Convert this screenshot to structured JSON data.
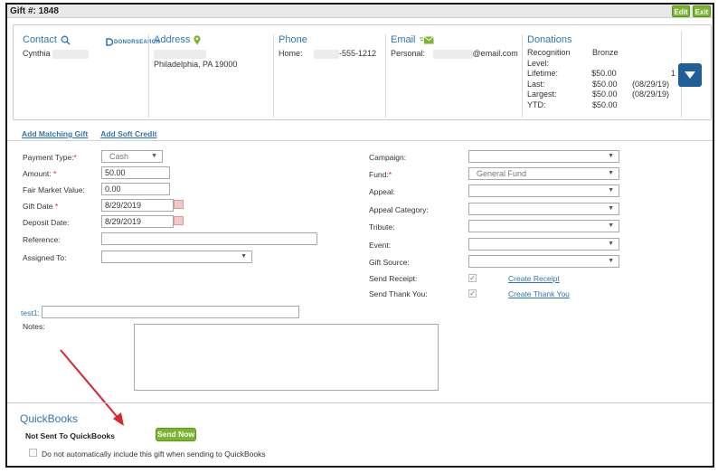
{
  "header": {
    "gift_title": "Gift #: 1848",
    "edit_label": "Edit",
    "exit_label": "Exit"
  },
  "contact": {
    "heading": "Contact",
    "name": "Cynthia",
    "brand": "DONORSEARCH"
  },
  "address": {
    "heading": "Address",
    "city_line": "Philadelphia, PA 19000"
  },
  "phone": {
    "heading": "Phone",
    "label": "Home:",
    "number": "-555-1212"
  },
  "email": {
    "heading": "Email",
    "label": "Personal:",
    "domain": "@email.com"
  },
  "donations": {
    "heading": "Donations",
    "rows": [
      {
        "label": "Recognition Level:",
        "amount": "Bronze",
        "extra": ""
      },
      {
        "label": "Lifetime:",
        "amount": "$50.00",
        "extra": "1"
      },
      {
        "label": "Last:",
        "amount": "$50.00",
        "extra": "(08/29/19)"
      },
      {
        "label": "Largest:",
        "amount": "$50.00",
        "extra": "(08/29/19)"
      },
      {
        "label": "YTD:",
        "amount": "$50.00",
        "extra": ""
      }
    ]
  },
  "links": {
    "add_matching_gift": "Add Matching Gift",
    "add_soft_credit": "Add Soft Credit"
  },
  "form": {
    "payment_type_label": "Payment Type:",
    "payment_type_value": "Cash",
    "amount_label": "Amount:",
    "amount_value": "50.00",
    "fmv_label": "Fair Market Value:",
    "fmv_value": "0.00",
    "gift_date_label": "Gift Date",
    "gift_date_value": "8/29/2019",
    "deposit_date_label": "Deposit Date:",
    "deposit_date_value": "8/29/2019",
    "reference_label": "Reference:",
    "reference_value": "",
    "assigned_to_label": "Assigned To:",
    "assigned_to_value": "",
    "campaign_label": "Campaign:",
    "campaign_value": "",
    "fund_label": "Fund:",
    "fund_value": "General Fund",
    "appeal_label": "Appeal:",
    "appeal_value": "",
    "appeal_category_label": "Appeal Category:",
    "appeal_category_value": "",
    "tribute_label": "Tribute:",
    "tribute_value": "",
    "event_label": "Event:",
    "event_value": "",
    "gift_source_label": "Gift Source:",
    "gift_source_value": "",
    "send_receipt_label": "Send Receipt:",
    "create_receipt": "Create Receipt",
    "send_thank_you_label": "Send Thank You:",
    "create_thank_you": "Create Thank You",
    "test1_label": "test1:",
    "test1_value": "",
    "notes_label": "Notes:",
    "notes_value": "",
    "required_mark": "*",
    "check_mark": "✓",
    "dropdown_arrow": "▼"
  },
  "quickbooks": {
    "title": "QuickBooks",
    "status": "Not Sent To QuickBooks",
    "send_now_label": "Send Now",
    "exclude_label": "Do not automatically include this gift when sending to QuickBooks"
  },
  "colors": {
    "link_blue": "#2e75b6",
    "green_button": "#7ab52f",
    "dark_blue": "#1f5f99",
    "arrow_red": "#d9262b"
  }
}
